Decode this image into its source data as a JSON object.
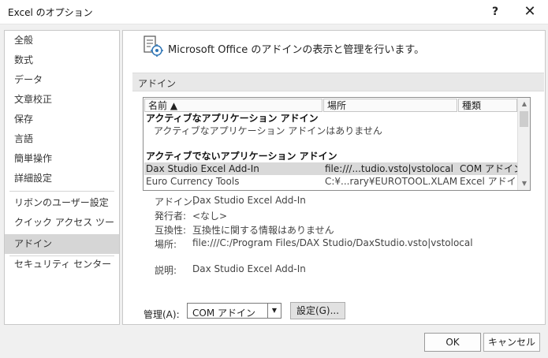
{
  "window": {
    "title": "Excel のオプション",
    "help": "?",
    "close": "✕"
  },
  "sidebar": {
    "items": [
      {
        "label": "全般",
        "selected": false
      },
      {
        "label": "数式",
        "selected": false
      },
      {
        "label": "データ",
        "selected": false
      },
      {
        "label": "文章校正",
        "selected": false
      },
      {
        "label": "保存",
        "selected": false
      },
      {
        "label": "言語",
        "selected": false
      },
      {
        "label": "簡単操作",
        "selected": false
      },
      {
        "label": "詳細設定",
        "selected": false
      },
      {
        "label": "リボンのユーザー設定",
        "selected": false
      },
      {
        "label": "クイック アクセス ツール バー",
        "selected": false
      },
      {
        "label": "アドイン",
        "selected": true
      },
      {
        "label": "セキュリティ センター",
        "selected": false
      }
    ]
  },
  "main": {
    "header": "Microsoft Office のアドインの表示と管理を行います。",
    "section_title": "アドイン",
    "columns": [
      "名前 ▲",
      "場所",
      "種類"
    ],
    "rows": [
      {
        "kind": "group",
        "name": "アクティブなアプリケーション アドイン",
        "location": "",
        "type": ""
      },
      {
        "kind": "note",
        "name": "アクティブなアプリケーション アドインはありません",
        "location": "",
        "type": ""
      },
      {
        "kind": "spacer",
        "name": "",
        "location": "",
        "type": ""
      },
      {
        "kind": "group",
        "name": "アクティブでないアプリケーション アドイン",
        "location": "",
        "type": ""
      },
      {
        "kind": "item-selected",
        "name": "Dax Studio Excel Add-In",
        "location": "file:///...tudio.vsto|vstolocal",
        "type": "COM アドイン"
      },
      {
        "kind": "item",
        "name": "Euro Currency Tools",
        "location": "C:¥...rary¥EUROTOOL.XLAM",
        "type": "Excel アドイン"
      }
    ],
    "details": {
      "addin_label": "アドイン:",
      "addin_value": "Dax Studio Excel Add-In",
      "publisher_label": "発行者:",
      "publisher_value": "<なし>",
      "compat_label": "互換性:",
      "compat_value": "互換性に関する情報はありません",
      "location_label": "場所:",
      "location_value": "file:///C:/Program Files/DAX Studio/DaxStudio.vsto|vstolocal",
      "description_label": "説明:",
      "description_value": "Dax Studio Excel Add-In"
    },
    "manage": {
      "label": "管理(A):",
      "selected": "COM アドイン",
      "go_label": "設定(G)..."
    }
  },
  "footer": {
    "ok": "OK",
    "cancel": "キャンセル"
  },
  "colors": {
    "selected_nav": "#d6d6d6",
    "selected_row": "#d9d9d9",
    "section_bar": "#e8e8e8",
    "icon_accent": "#2e75b6"
  }
}
